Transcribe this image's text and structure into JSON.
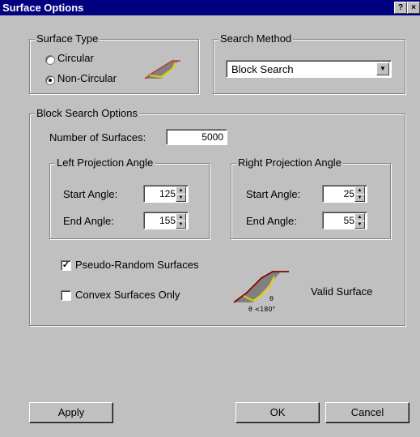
{
  "window": {
    "title": "Surface Options",
    "help_glyph": "?",
    "close_glyph": "×",
    "title_bar_color": "#000080",
    "face_color": "#c0c0c0"
  },
  "surface_type": {
    "legend": "Surface Type",
    "options": [
      {
        "label": "Circular",
        "selected": false
      },
      {
        "label": "Non-Circular",
        "selected": true
      }
    ]
  },
  "search_method": {
    "legend": "Search Method",
    "selected": "Block Search"
  },
  "block_search": {
    "legend": "Block Search Options",
    "num_surfaces_label": "Number of Surfaces:",
    "num_surfaces_value": "5000",
    "left_projection": {
      "legend": "Left Projection Angle",
      "start_label": "Start Angle:",
      "start_value": "125",
      "end_label": "End Angle:",
      "end_value": "155"
    },
    "right_projection": {
      "legend": "Right Projection Angle",
      "start_label": "Start Angle:",
      "start_value": "25",
      "end_label": "End Angle:",
      "end_value": "55"
    },
    "pseudo_random": {
      "label": "Pseudo-Random Surfaces",
      "checked": true
    },
    "convex_only": {
      "label": "Convex Surfaces Only",
      "checked": false
    },
    "diagram": {
      "theta_label": "θ",
      "constraint_label": "θ <180°"
    },
    "valid_surface_label": "Valid Surface"
  },
  "buttons": {
    "apply": "Apply",
    "ok": "OK",
    "cancel": "Cancel"
  },
  "icons": {
    "spin_up": "up-arrow-icon",
    "spin_down": "down-arrow-icon",
    "dropdown": "chevron-down-icon"
  }
}
